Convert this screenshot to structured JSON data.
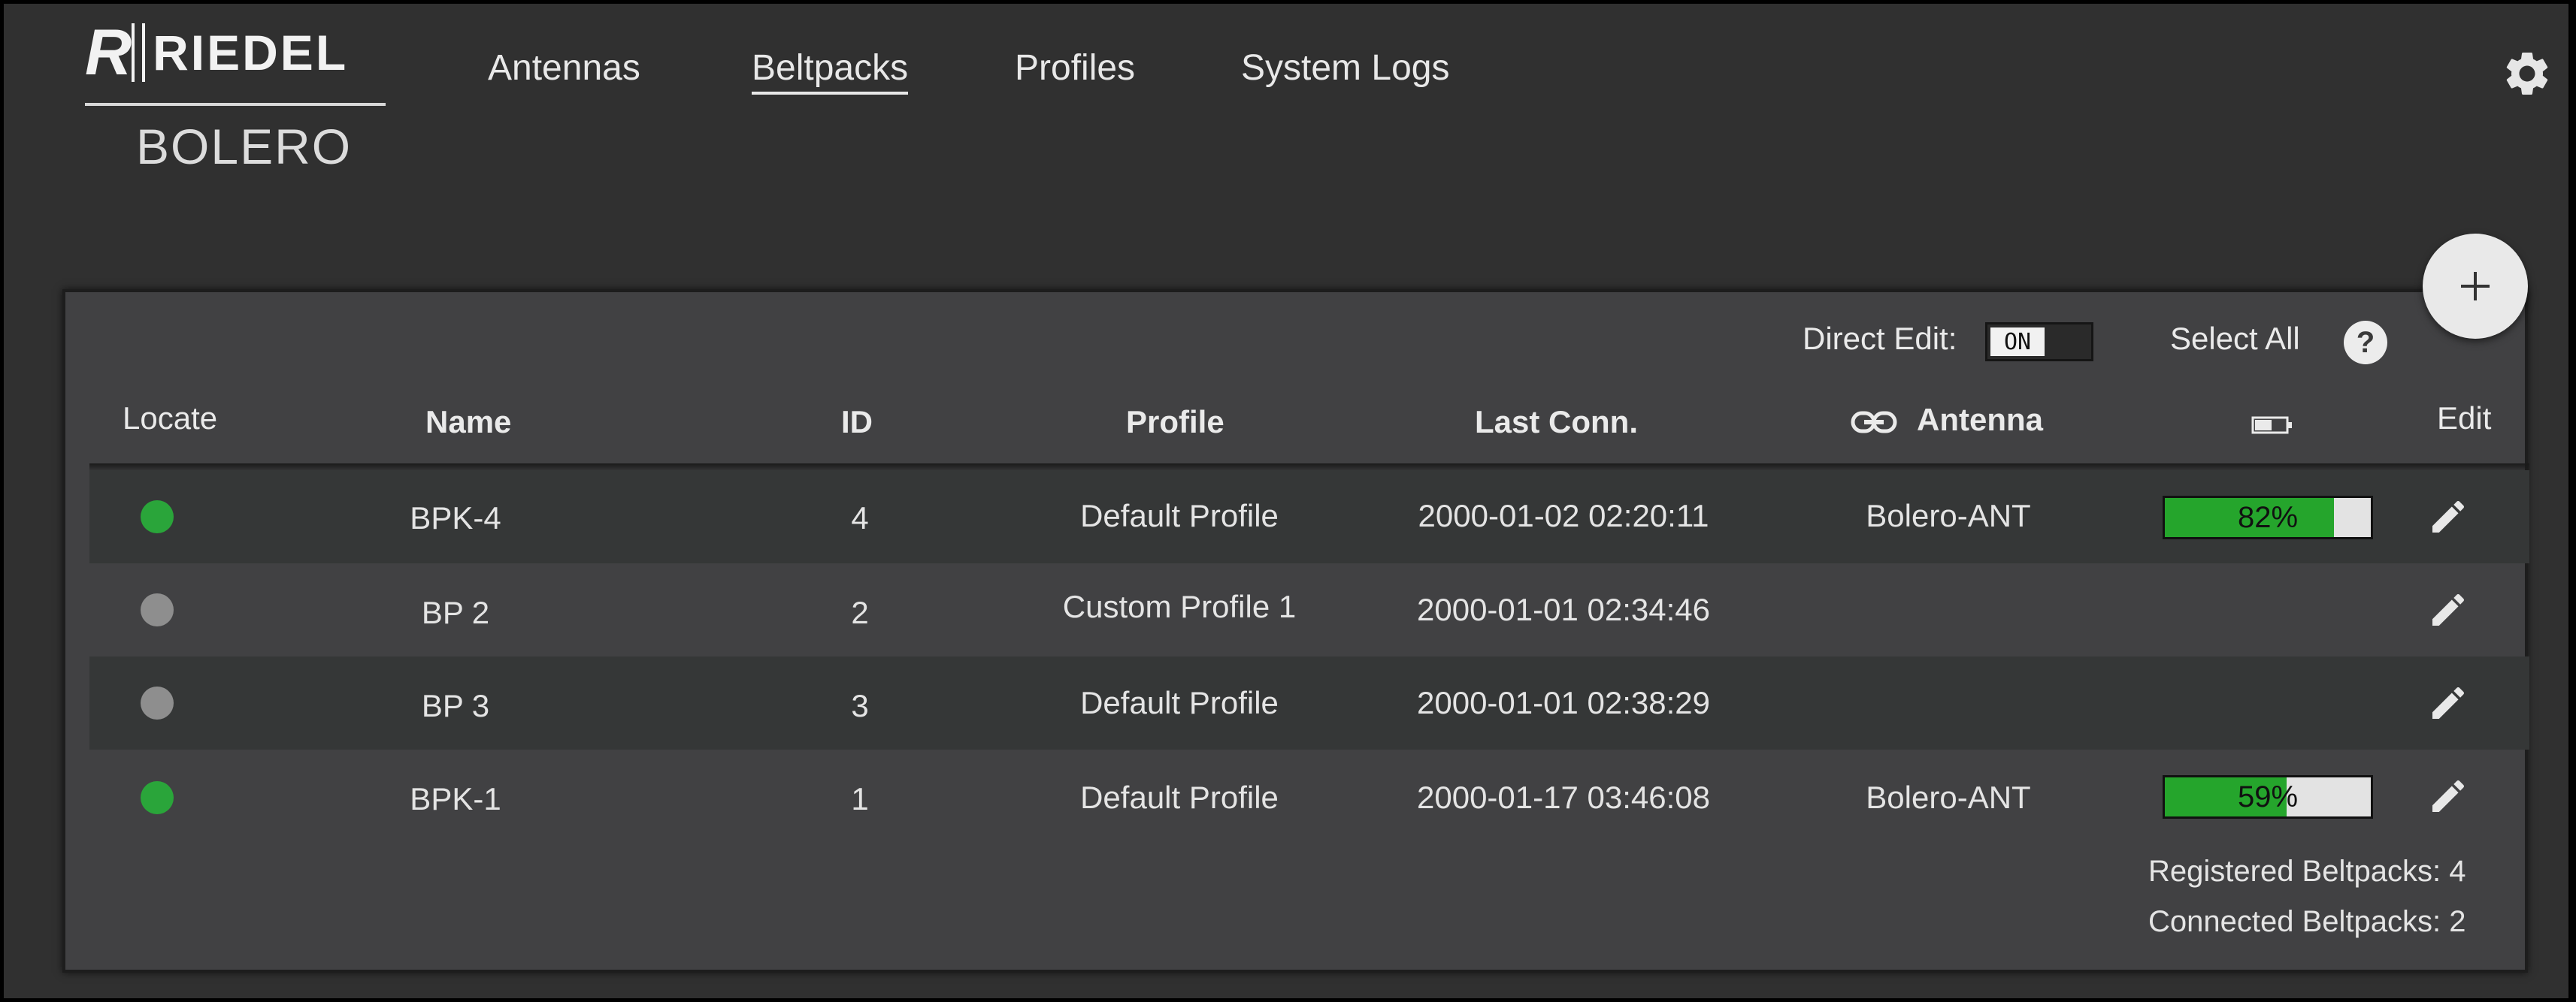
{
  "brand": {
    "logo_text": "RIEDEL",
    "product": "BOLERO"
  },
  "nav": {
    "items": [
      {
        "label": "Antennas",
        "active": false
      },
      {
        "label": "Beltpacks",
        "active": true
      },
      {
        "label": "Profiles",
        "active": false
      },
      {
        "label": "System Logs",
        "active": false
      }
    ]
  },
  "toolbar": {
    "direct_edit_label": "Direct Edit:",
    "direct_edit_state": "ON",
    "select_all_label": "Select All",
    "help_symbol": "?",
    "add_symbol": "+"
  },
  "table": {
    "headers": {
      "locate": "Locate",
      "name": "Name",
      "id": "ID",
      "profile": "Profile",
      "last_conn": "Last Conn.",
      "antenna": "Antenna",
      "battery_icon": "battery-icon",
      "edit": "Edit"
    },
    "rows": [
      {
        "status": "connected",
        "name": "BPK-4",
        "id": "4",
        "profile": "Default Profile",
        "last_conn": "2000-01-02 02:20:11",
        "antenna": "Bolero-ANT",
        "battery": "82%",
        "battery_level": 0.82
      },
      {
        "status": "offline",
        "name": "BP 2",
        "id": "2",
        "profile": "Custom Profile 1",
        "last_conn": "2000-01-01 02:34:46",
        "antenna": "",
        "battery": "",
        "battery_level": null
      },
      {
        "status": "offline",
        "name": "BP 3",
        "id": "3",
        "profile": "Default Profile",
        "last_conn": "2000-01-01 02:38:29",
        "antenna": "",
        "battery": "",
        "battery_level": null
      },
      {
        "status": "connected",
        "name": "BPK-1",
        "id": "1",
        "profile": "Default Profile",
        "last_conn": "2000-01-17 03:46:08",
        "antenna": "Bolero-ANT",
        "battery": "59%",
        "battery_level": 0.59
      }
    ]
  },
  "summary": {
    "registered": "Registered Beltpacks: 4",
    "connected": "Connected Beltpacks: 2"
  },
  "colors": {
    "connected": "#2aa53a",
    "offline": "#8e8e8e",
    "battery_fill": "#25a52c"
  }
}
